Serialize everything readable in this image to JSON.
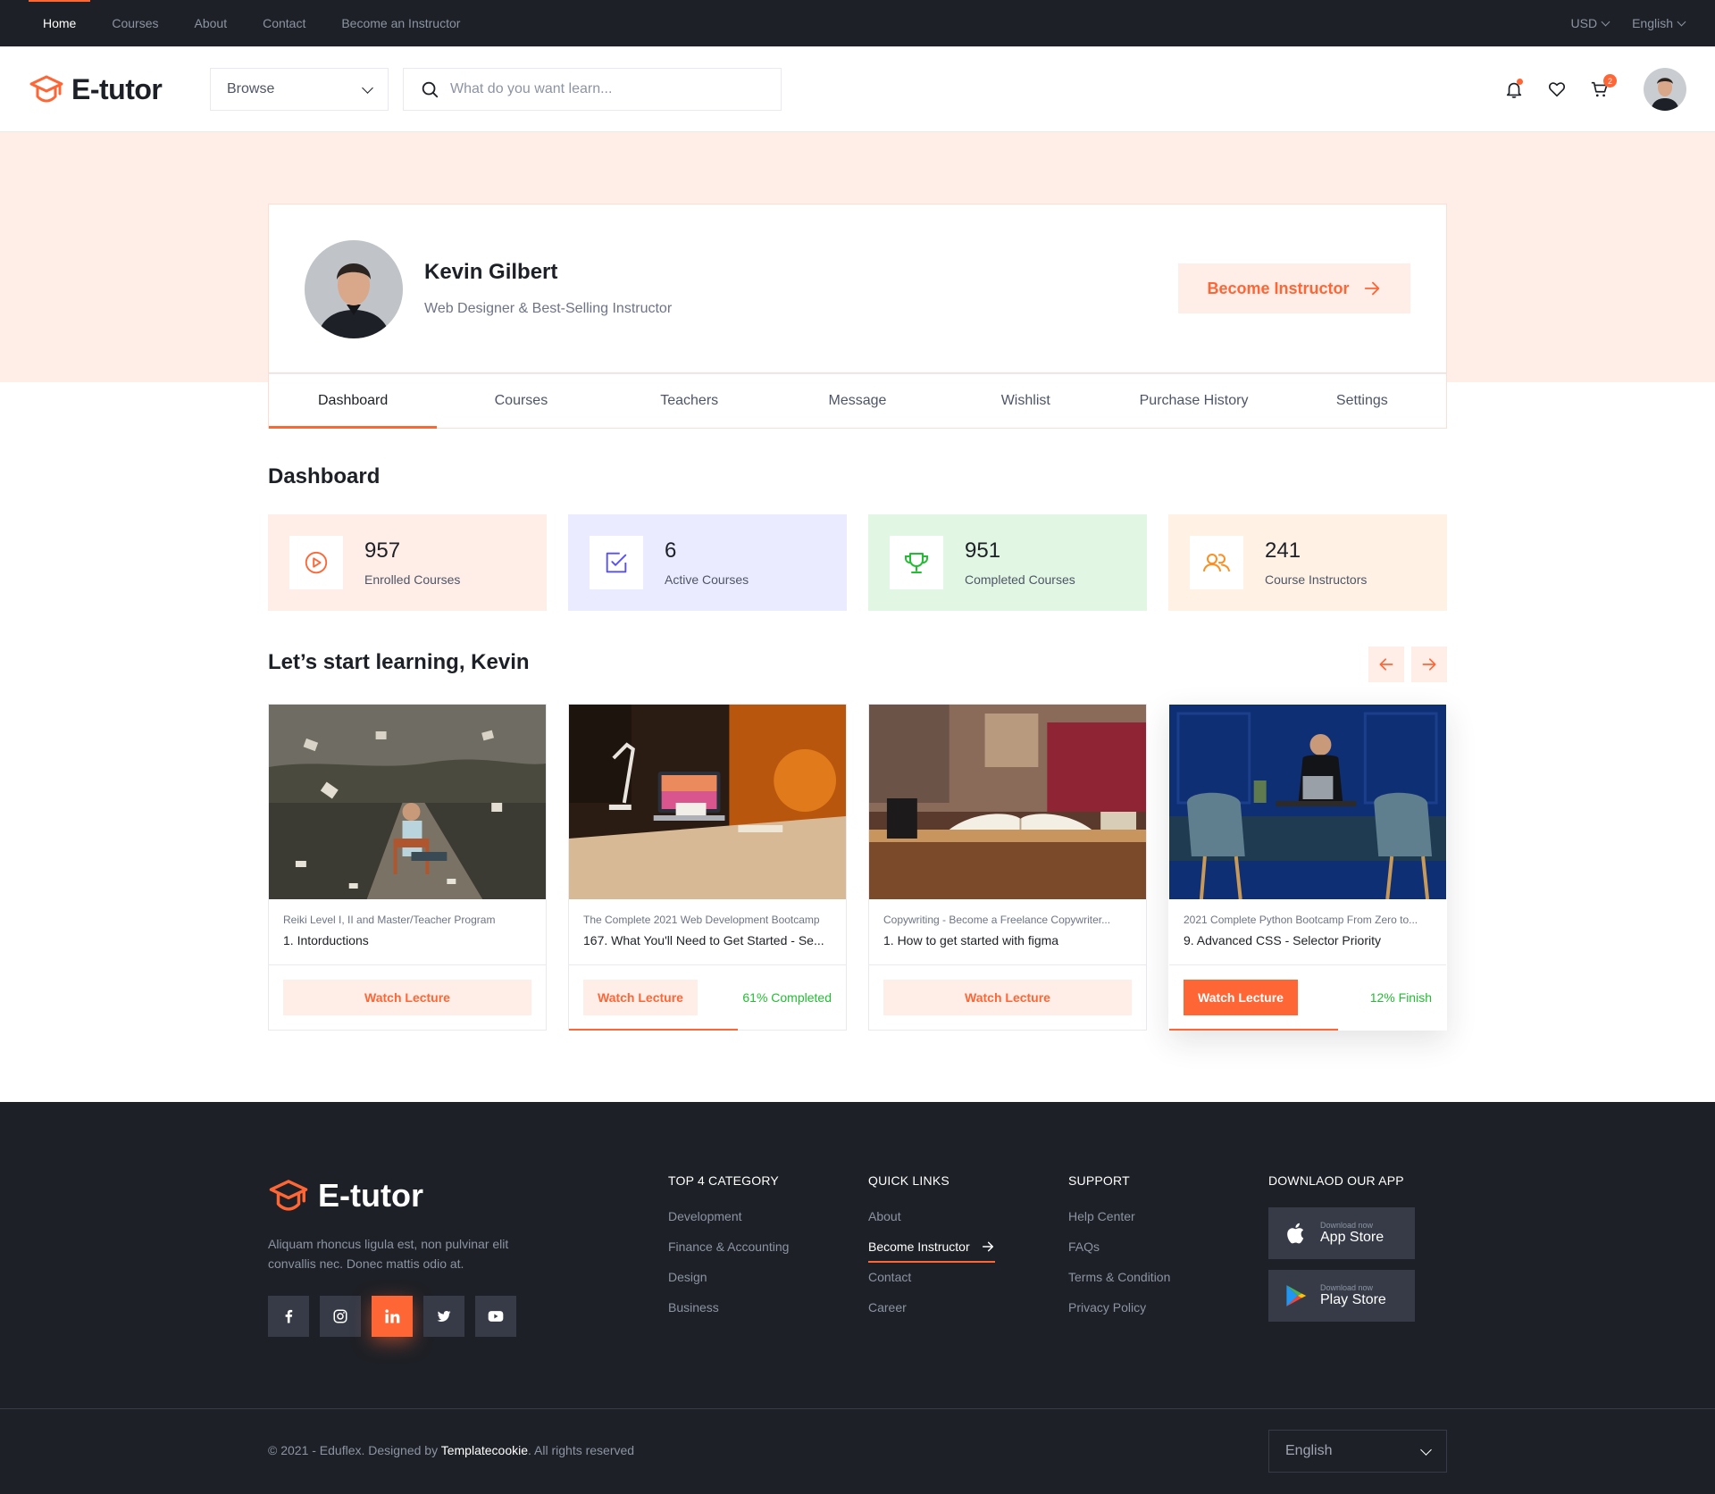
{
  "topnav": {
    "links": [
      {
        "label": "Home",
        "active": true
      },
      {
        "label": "Courses",
        "active": false
      },
      {
        "label": "About",
        "active": false
      },
      {
        "label": "Contact",
        "active": false
      },
      {
        "label": "Become an Instructor",
        "active": false
      }
    ],
    "currency": "USD",
    "language": "English"
  },
  "header": {
    "brand": "E-tutor",
    "browse_label": "Browse",
    "search_placeholder": "What do you want learn...",
    "cart_count": "2",
    "icons": [
      "bell-icon",
      "heart-icon",
      "cart-icon"
    ]
  },
  "profile": {
    "name": "Kevin Gilbert",
    "role": "Web Designer & Best-Selling Instructor",
    "become_instructor_label": "Become Instructor"
  },
  "tabs": [
    {
      "label": "Dashboard",
      "active": true
    },
    {
      "label": "Courses",
      "active": false
    },
    {
      "label": "Teachers",
      "active": false
    },
    {
      "label": "Message",
      "active": false
    },
    {
      "label": "Wishlist",
      "active": false
    },
    {
      "label": "Purchase History",
      "active": false
    },
    {
      "label": "Settings",
      "active": false
    }
  ],
  "dashboard": {
    "title": "Dashboard",
    "stats": [
      {
        "value": "957",
        "label": "Enrolled Courses",
        "icon": "play-circle-icon",
        "bg": "#ffeee8",
        "color": "#ff6636"
      },
      {
        "value": "6",
        "label": "Active Courses",
        "icon": "checksquare-icon",
        "bg": "#ebebff",
        "color": "#564ffd"
      },
      {
        "value": "951",
        "label": "Completed Courses",
        "icon": "trophy-icon",
        "bg": "#e1f7e3",
        "color": "#23bd33"
      },
      {
        "value": "241",
        "label": "Course Instructors",
        "icon": "users-icon",
        "bg": "#fff2e5",
        "color": "#fd8e1f"
      }
    ]
  },
  "learning": {
    "title": "Let’s start learning, Kevin",
    "cards": [
      {
        "course": "Reiki Level I, II and Master/Teacher Program",
        "lecture": "1. Intorductions",
        "button": "Watch Lecture",
        "progress_label": "",
        "progress": 0
      },
      {
        "course": "The Complete 2021 Web Development Bootcamp",
        "lecture": "167. What You'll Need to Get Started - Se...",
        "button": "Watch Lecture",
        "progress_label": "61% Completed",
        "progress": 0.61
      },
      {
        "course": "Copywriting - Become a Freelance Copywriter...",
        "lecture": "1. How to get started with figma",
        "button": "Watch Lecture",
        "progress_label": "",
        "progress": 0
      },
      {
        "course": "2021 Complete Python Bootcamp From Zero to...",
        "lecture": "9. Advanced CSS - Selector Priority",
        "button": "Watch Lecture",
        "progress_label": "12% Finish",
        "progress": 0.61
      }
    ]
  },
  "footer": {
    "brand": "E-tutor",
    "description": "Aliquam rhoncus ligula est, non pulvinar elit convallis nec. Donec mattis odio at.",
    "socials": [
      "facebook-icon",
      "instagram-icon",
      "linkedin-icon",
      "twitter-icon",
      "youtube-icon"
    ],
    "columns": [
      {
        "title": "TOP 4 CATEGORY",
        "items": [
          "Development",
          "Finance & Accounting",
          "Design",
          "Business"
        ]
      },
      {
        "title": "QUICK LINKS",
        "items": [
          "About",
          "Become Instructor",
          "Contact",
          "Career"
        ]
      },
      {
        "title": "SUPPORT",
        "items": [
          "Help Center",
          "FAQs",
          "Terms & Condition",
          "Privacy Policy"
        ]
      }
    ],
    "app": {
      "title": "DOWNLAOD OUR APP",
      "appstore_small": "Download now",
      "appstore_big": "App Store",
      "playstore_small": "Download now",
      "playstore_big": "Play Store"
    },
    "copyright_prefix": "© 2021 - Eduflex. Designed by",
    "copyright_link": "Templatecookie",
    "copyright_suffix": ". All rights reserved",
    "language": "English"
  }
}
